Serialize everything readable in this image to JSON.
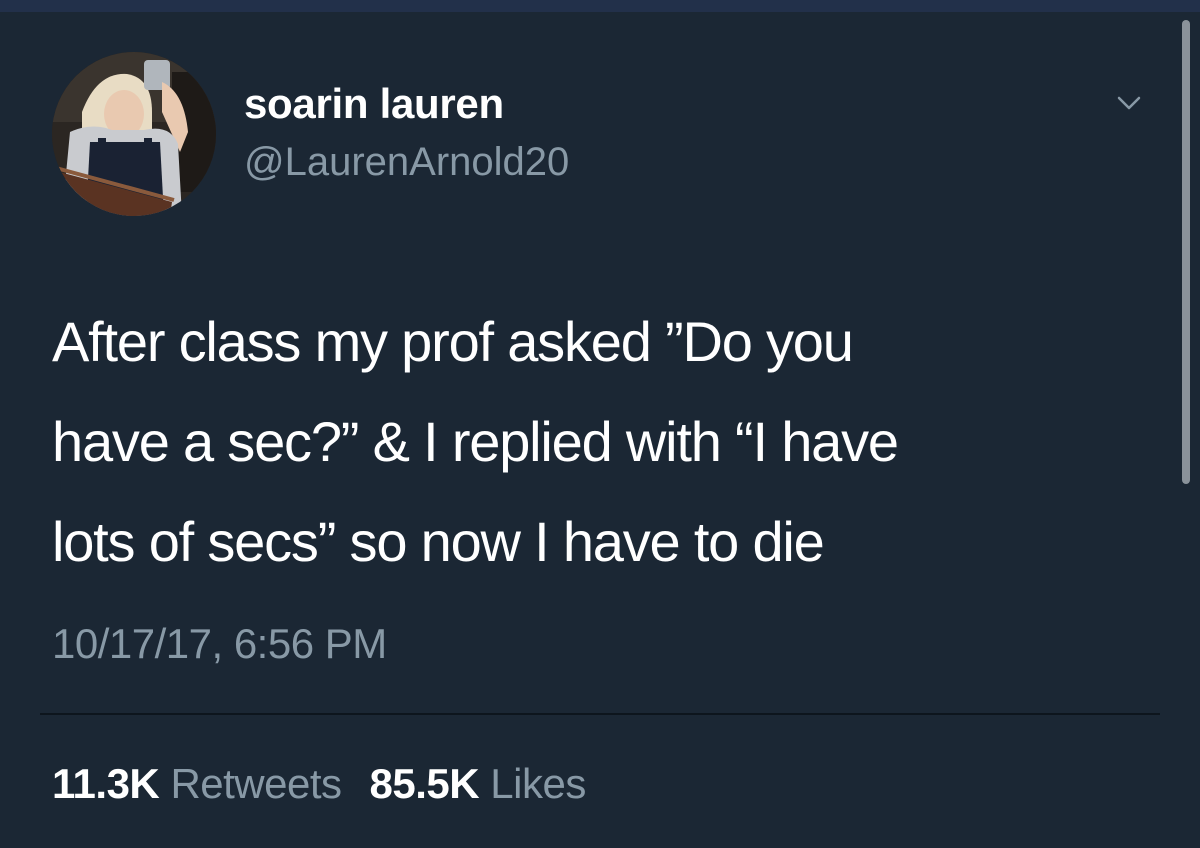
{
  "tweet": {
    "author": {
      "display_name": "soarin lauren",
      "handle": "@LaurenArnold20"
    },
    "text_lines": [
      "After class my prof asked ”Do you",
      "have a sec?” & I replied with “I have",
      "lots of secs” so now I have to die"
    ],
    "timestamp": "10/17/17, 6:56 PM",
    "stats": {
      "retweets_count": "11.3K",
      "retweets_label": "Retweets",
      "likes_count": "85.5K",
      "likes_label": "Likes"
    }
  },
  "icons": {
    "menu": "chevron-down-icon"
  },
  "colors": {
    "background": "#1b2734",
    "secondary_text": "#8899a6",
    "primary_text": "#ffffff"
  }
}
